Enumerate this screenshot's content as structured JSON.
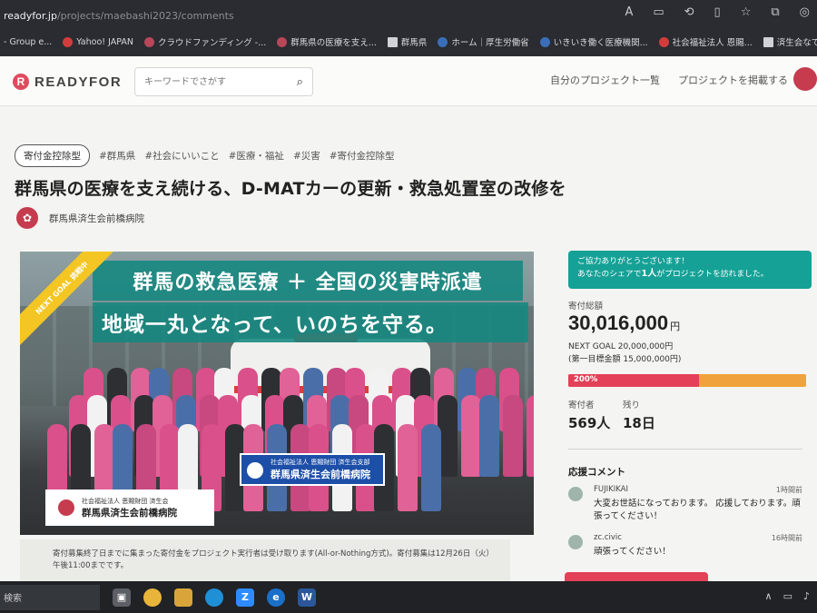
{
  "browser": {
    "url_host": "readyfor.jp",
    "url_path": "/projects/maebashi2023/comments",
    "bookmarks": [
      "- Group e...",
      "Yahoo! JAPAN",
      "クラウドファンディング -...",
      "群馬県の医療を支え...",
      "群馬県",
      "ホーム｜厚生労働省",
      "いきいき働く医療機関...",
      "社会福祉法人 恩賜...",
      "済生会なでしこメ"
    ]
  },
  "header": {
    "logo_text": "READYFOR",
    "search_placeholder": "キーワードでさがす",
    "links": [
      "自分のプロジェクト一覧",
      "プロジェクトを掲載する"
    ]
  },
  "project": {
    "badge": "寄付金控除型",
    "tags": [
      "#群馬県",
      "#社会にいいこと",
      "#医療・福祉",
      "#災害",
      "#寄付金控除型"
    ],
    "title": "群馬県の医療を支え続ける、D-MATカーの更新・救急処置室の改修を",
    "owner": "群馬県済生会前橋病院"
  },
  "hero": {
    "headline_1": "群馬の救急医療 ＋ 全国の災害時派遣",
    "headline_2": "地域一丸となって、いのちを守る。",
    "ribbon": "NEXT GOAL 挑戦中",
    "flag_small": "社会福祉法人 恩賜財団 済生会支部",
    "flag_big": "群馬県済生会前橋病院",
    "box_small": "社会福祉法人 恩賜財団 済生会",
    "box_big": "群馬県済生会前橋病院"
  },
  "note": {
    "line_1": "寄付募集終了日までに集まった寄付金をプロジェクト実行者は受け取ります(All-or-Nothing方式)。寄付募集は12月26日（火）",
    "line_2": "午後11:00までです。"
  },
  "panel": {
    "thanks_line_1": "ご協力ありがとうございます！",
    "thanks_line_2_a": "あなたのシェアで",
    "thanks_line_2_b": "1人",
    "thanks_line_2_c": "がプロジェクトを訪れました。",
    "total_label": "寄付総額",
    "total_amount": "30,016,000",
    "total_unit": "円",
    "next_goal": "NEXT GOAL 20,000,000円",
    "first_goal": "(第一目標金額 15,000,000円)",
    "progress_label": "200%",
    "progress_fill": 0.55,
    "donors_label": "寄付者",
    "donors_value": "569人",
    "remaining_label": "残り",
    "remaining_value": "18日",
    "comments_title": "応援コメント",
    "comments": [
      {
        "name": "FUJIKIKAI",
        "time": "1時間前",
        "text": "大変お世話になっております。 応援しております。頑張ってください！"
      },
      {
        "name": "zc.civic",
        "time": "16時間前",
        "text": "頑張ってください！"
      }
    ]
  },
  "taskbar": {
    "search_text": "検索",
    "icons": [
      "task-view",
      "chrome",
      "explorer",
      "edge",
      "zoom",
      "ie",
      "word"
    ]
  },
  "colors": {
    "accent": "#e44057",
    "teal": "#16a196",
    "progress_bg": "#f0a23c"
  }
}
